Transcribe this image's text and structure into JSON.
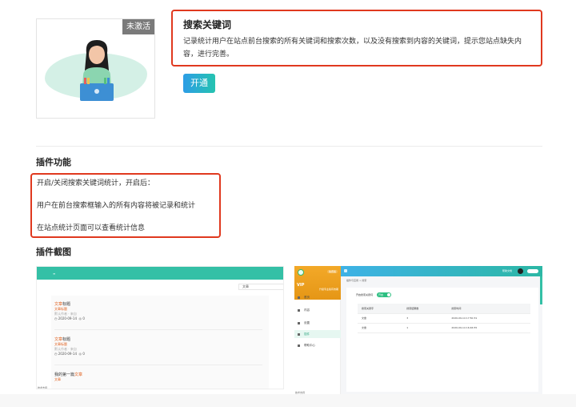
{
  "card": {
    "badge": "未激活"
  },
  "description": {
    "title": "搜索关键词",
    "text": "记录统计用户在站点前台搜索的所有关键词和搜索次数，以及没有搜索到内容的关键词，提示您站点缺失内容，进行完善。"
  },
  "open_button": "开通",
  "features": {
    "heading": "插件功能",
    "lines": [
      "开启/关闭搜索关键词统计，开启后：",
      "用户在前台搜索框输入的所有内容将被记录和统计",
      "在站点统计页面可以查看统计信息"
    ]
  },
  "screenshots": {
    "heading": "插件截图",
    "shot1": {
      "search_value": "文章",
      "search_button": "搜索",
      "articles": [
        {
          "prefix": "",
          "highlight": "文章",
          "suffix": "标题",
          "category": "文章标题",
          "meta": "默认作者 · 来自",
          "date": "2020-09-14",
          "views": "0"
        },
        {
          "prefix": "",
          "highlight": "文章",
          "suffix": "标题",
          "category": "文章标题",
          "meta": "默认作者 · 来自",
          "date": "2020-09-14",
          "views": "0"
        },
        {
          "prefix": "我的第一篇",
          "highlight": "文章",
          "suffix": "",
          "category": "文章",
          "meta": "",
          "date": "",
          "views": ""
        }
      ],
      "footer": "技术支持"
    },
    "shot2": {
      "brand_tag": "免费版",
      "vip": "VIP",
      "vip_sub": "升级专业版有效期",
      "nav": [
        "首页",
        "内容",
        "设置",
        "插件",
        "帮助中心"
      ],
      "active_nav": 3,
      "footer": "技术支持",
      "top_right": "帮助文档",
      "breadcrumb": "插件与应用 > 搜索",
      "toggle_label": "开启搜索关键词",
      "toggle_text": "开启",
      "table": {
        "headers": [
          "搜索关键字",
          "搜索结果数",
          "搜索时间"
        ],
        "rows": [
          [
            "文章",
            "3",
            "2020-09-14 17:50:31"
          ],
          [
            "文章",
            "1",
            "2020-09-14 16:46:55"
          ]
        ]
      }
    }
  }
}
